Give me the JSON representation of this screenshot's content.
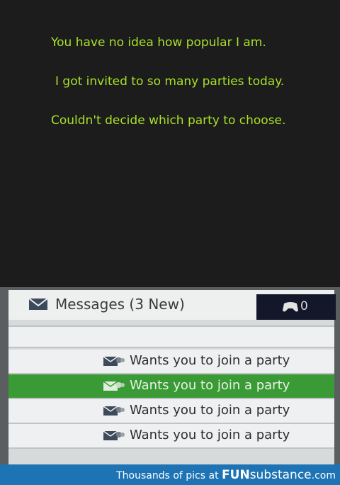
{
  "caption": {
    "line1": "You have no idea how popular I am.",
    "line2": "I got invited to so many parties today.",
    "line3": "Couldn't decide which party to choose."
  },
  "messages": {
    "title": "Messages (3 New)",
    "controller_count": "0",
    "icons": {
      "mail": "envelope-icon",
      "controller": "controller-icon",
      "party": "party-invite-icon"
    },
    "items": [
      {
        "label": "Wants you to join a party",
        "selected": false
      },
      {
        "label": "Wants you to join a party",
        "selected": true
      },
      {
        "label": "Wants you to join a party",
        "selected": false
      },
      {
        "label": "Wants you to join a party",
        "selected": false
      }
    ]
  },
  "footer": {
    "prefix": "Thousands of pics at",
    "brand_bold": "FUN",
    "brand_rest": "substance",
    "domain": ".com"
  },
  "colors": {
    "caption": "#a8e227",
    "selected_row": "#3a9a35",
    "footer_bg": "#1e73b5",
    "page_bg": "#1c1c1c"
  }
}
